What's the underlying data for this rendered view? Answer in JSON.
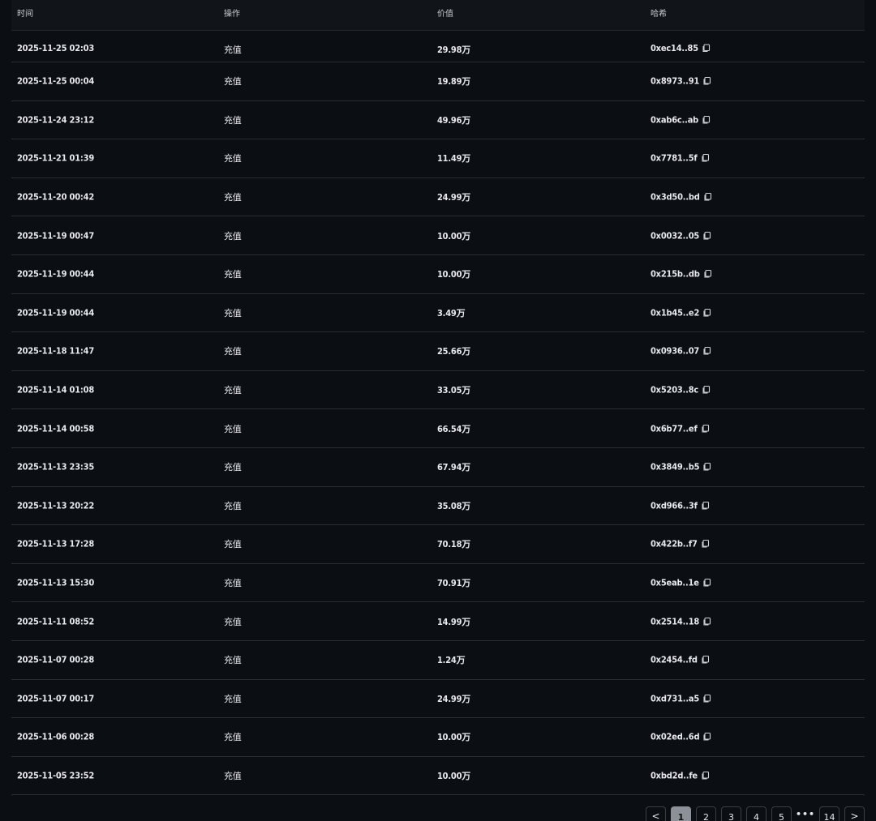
{
  "table": {
    "headers": {
      "time": "时间",
      "operation": "操作",
      "value": "价值",
      "hash": "哈希"
    },
    "rows": [
      {
        "time": "2025-11-25 02:03",
        "op": "充值",
        "value": "29.98万",
        "hash": "0xec14..85"
      },
      {
        "time": "2025-11-25 00:04",
        "op": "充值",
        "value": "19.89万",
        "hash": "0x8973..91"
      },
      {
        "time": "2025-11-24 23:12",
        "op": "充值",
        "value": "49.96万",
        "hash": "0xab6c..ab"
      },
      {
        "time": "2025-11-21 01:39",
        "op": "充值",
        "value": "11.49万",
        "hash": "0x7781..5f"
      },
      {
        "time": "2025-11-20 00:42",
        "op": "充值",
        "value": "24.99万",
        "hash": "0x3d50..bd"
      },
      {
        "time": "2025-11-19 00:47",
        "op": "充值",
        "value": "10.00万",
        "hash": "0x0032..05"
      },
      {
        "time": "2025-11-19 00:44",
        "op": "充值",
        "value": "10.00万",
        "hash": "0x215b..db"
      },
      {
        "time": "2025-11-19 00:44",
        "op": "充值",
        "value": "3.49万",
        "hash": "0x1b45..e2"
      },
      {
        "time": "2025-11-18 11:47",
        "op": "充值",
        "value": "25.66万",
        "hash": "0x0936..07"
      },
      {
        "time": "2025-11-14 01:08",
        "op": "充值",
        "value": "33.05万",
        "hash": "0x5203..8c"
      },
      {
        "time": "2025-11-14 00:58",
        "op": "充值",
        "value": "66.54万",
        "hash": "0x6b77..ef"
      },
      {
        "time": "2025-11-13 23:35",
        "op": "充值",
        "value": "67.94万",
        "hash": "0x3849..b5"
      },
      {
        "time": "2025-11-13 20:22",
        "op": "充值",
        "value": "35.08万",
        "hash": "0xd966..3f"
      },
      {
        "time": "2025-11-13 17:28",
        "op": "充值",
        "value": "70.18万",
        "hash": "0x422b..f7"
      },
      {
        "time": "2025-11-13 15:30",
        "op": "充值",
        "value": "70.91万",
        "hash": "0x5eab..1e"
      },
      {
        "time": "2025-11-11 08:52",
        "op": "充值",
        "value": "14.99万",
        "hash": "0x2514..18"
      },
      {
        "time": "2025-11-07 00:28",
        "op": "充值",
        "value": "1.24万",
        "hash": "0x2454..fd"
      },
      {
        "time": "2025-11-07 00:17",
        "op": "充值",
        "value": "24.99万",
        "hash": "0xd731..a5"
      },
      {
        "time": "2025-11-06 00:28",
        "op": "充值",
        "value": "10.00万",
        "hash": "0x02ed..6d"
      },
      {
        "time": "2025-11-05 23:52",
        "op": "充值",
        "value": "10.00万",
        "hash": "0xbd2d..fe"
      }
    ]
  },
  "pagination": {
    "prev_icon": "chevron-left-icon",
    "next_icon": "chevron-right-icon",
    "prev_label": "<",
    "next_label": ">",
    "pages": [
      "1",
      "2",
      "3",
      "4",
      "5"
    ],
    "ellipsis": "•••",
    "last_page": "14",
    "current_page": "1"
  },
  "colors": {
    "background": "#0b0e13",
    "header_bg": "#111419",
    "row_divider": "#2a2e35",
    "text": "#e8eaed",
    "active_page_bg": "#8c9097"
  }
}
